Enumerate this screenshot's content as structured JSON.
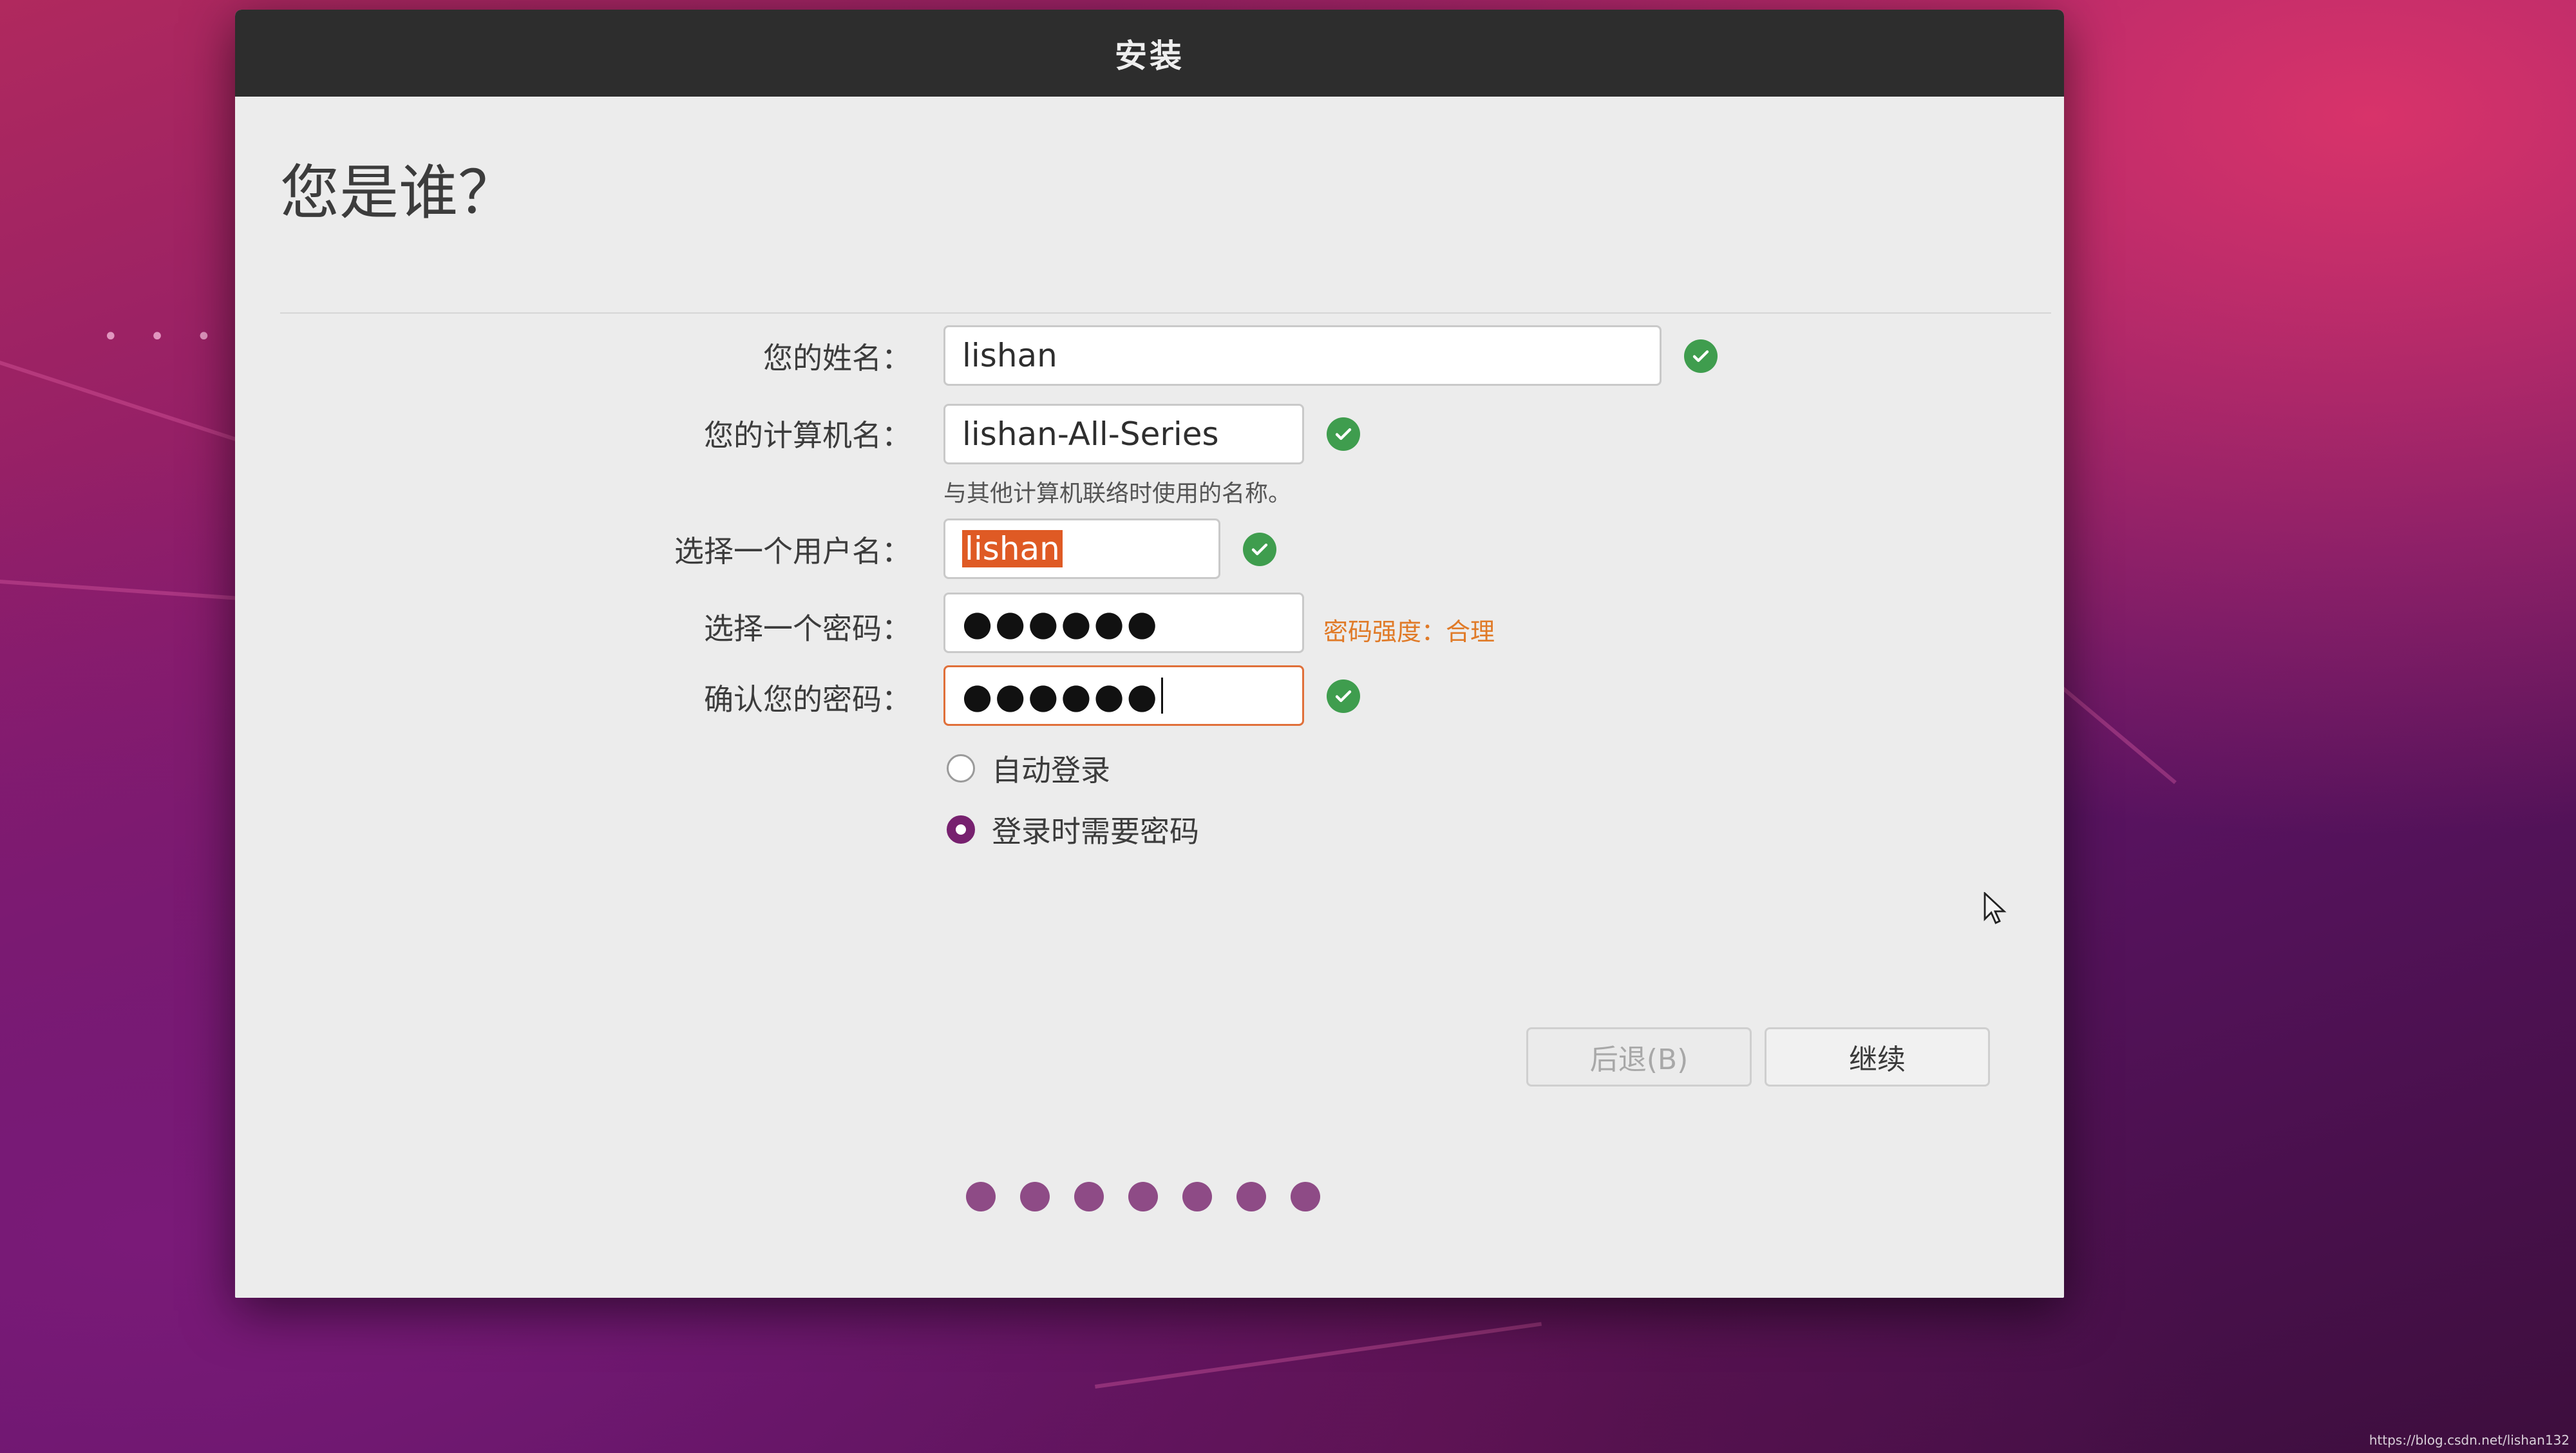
{
  "window": {
    "title": "安装"
  },
  "page": {
    "title": "您是谁？"
  },
  "form": {
    "name": {
      "label": "您的姓名：",
      "value": "lishan",
      "valid": true
    },
    "computer": {
      "label": "您的计算机名：",
      "value": "lishan-All-Series",
      "hint": "与其他计算机联络时使用的名称。",
      "valid": true
    },
    "username": {
      "label": "选择一个用户名：",
      "value": "lishan",
      "selected": true,
      "valid": true
    },
    "password": {
      "label": "选择一个密码：",
      "masked": "●●●●●●",
      "strength": "密码强度：合理"
    },
    "confirm": {
      "label": "确认您的密码：",
      "masked": "●●●●●●",
      "valid": true
    }
  },
  "login_options": [
    {
      "label": "自动登录",
      "checked": false
    },
    {
      "label": "登录时需要密码",
      "checked": true
    }
  ],
  "buttons": {
    "back": "后退(B)",
    "continue": "继续"
  },
  "progress": {
    "total": 7
  },
  "watermark": "https://blog.csdn.net/lishan132",
  "colors": {
    "accent": "#77216f",
    "check": "#3f9d4e",
    "focus": "#e0703a",
    "strength": "#e07a27"
  }
}
